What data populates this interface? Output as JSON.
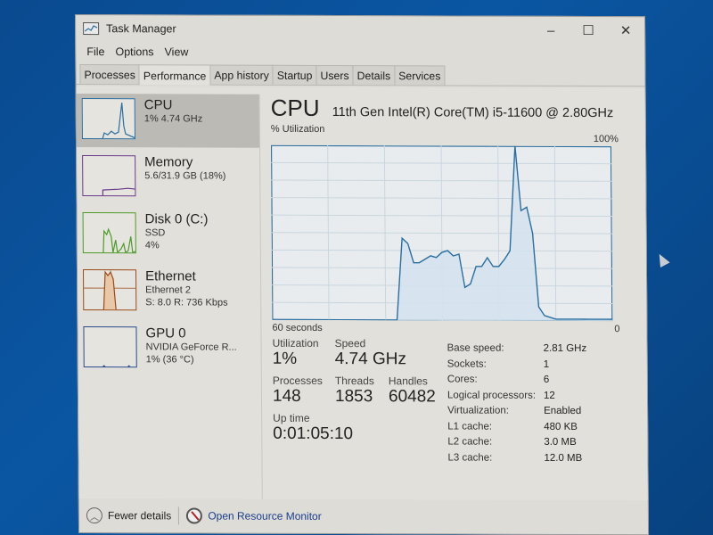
{
  "window": {
    "title": "Task Manager",
    "controls": {
      "minimize": "–",
      "maximize": "☐",
      "close": "✕"
    }
  },
  "menu": [
    "File",
    "Options",
    "View"
  ],
  "tabs": [
    {
      "label": "Processes",
      "active": false
    },
    {
      "label": "Performance",
      "active": true
    },
    {
      "label": "App history",
      "active": false
    },
    {
      "label": "Startup",
      "active": false
    },
    {
      "label": "Users",
      "active": false
    },
    {
      "label": "Details",
      "active": false
    },
    {
      "label": "Services",
      "active": false
    }
  ],
  "sidebar": {
    "items": [
      {
        "title": "CPU",
        "lines": [
          "1% 4.74 GHz"
        ],
        "color": "#2a6ea0",
        "active": true
      },
      {
        "title": "Memory",
        "lines": [
          "5.6/31.9 GB (18%)"
        ],
        "color": "#6a3a8c",
        "active": false
      },
      {
        "title": "Disk 0 (C:)",
        "lines": [
          "SSD",
          "4%"
        ],
        "color": "#4d9a2a",
        "active": false
      },
      {
        "title": "Ethernet",
        "lines": [
          "Ethernet 2",
          "S: 8.0  R: 736 Kbps"
        ],
        "color": "#9a4a1a",
        "active": false
      },
      {
        "title": "GPU 0",
        "lines": [
          "NVIDIA GeForce R...",
          "1% (36 °C)"
        ],
        "color": "#2a4a8c",
        "active": false
      }
    ]
  },
  "main": {
    "title": "CPU",
    "model": "11th Gen Intel(R) Core(TM) i5-11600 @ 2.80GHz",
    "graph_label": "% Utilization",
    "graph_max": "100%",
    "graph_left": "60 seconds",
    "graph_right": "0"
  },
  "stats": {
    "utilization_label": "Utilization",
    "utilization": "1%",
    "speed_label": "Speed",
    "speed": "4.74 GHz",
    "processes_label": "Processes",
    "processes": "148",
    "threads_label": "Threads",
    "threads": "1853",
    "handles_label": "Handles",
    "handles": "60482",
    "uptime_label": "Up time",
    "uptime": "0:01:05:10"
  },
  "specs": [
    {
      "label": "Base speed:",
      "value": "2.81 GHz"
    },
    {
      "label": "Sockets:",
      "value": "1"
    },
    {
      "label": "Cores:",
      "value": "6"
    },
    {
      "label": "Logical processors:",
      "value": "12"
    },
    {
      "label": "Virtualization:",
      "value": "Enabled"
    },
    {
      "label": "L1 cache:",
      "value": "480 KB"
    },
    {
      "label": "L2 cache:",
      "value": "3.0 MB"
    },
    {
      "label": "L3 cache:",
      "value": "12.0 MB"
    }
  ],
  "footer": {
    "fewer_details": "Fewer details",
    "resource_monitor": "Open Resource Monitor"
  },
  "colors": {
    "cpu_line": "#2a6ea0",
    "cpu_fill": "#d4e3ee",
    "grid": "#c9d6df",
    "desktop": "#0a4a8f"
  },
  "chart_data": {
    "type": "area",
    "title": "CPU % Utilization",
    "xlabel": "60 seconds",
    "ylabel": "% Utilization",
    "xlim": [
      60,
      0
    ],
    "ylim": [
      0,
      100
    ],
    "grid": true,
    "x": [
      60,
      59,
      58,
      57,
      56,
      55,
      54,
      53,
      52,
      51,
      50,
      49,
      48,
      47,
      46,
      45,
      44,
      43,
      42,
      41,
      40,
      39,
      38,
      37,
      36,
      35,
      34,
      33,
      32,
      31,
      30,
      29,
      28,
      27,
      26,
      25,
      24,
      23,
      22,
      21,
      20,
      19,
      18,
      17,
      16,
      15,
      14,
      13,
      12,
      11,
      10,
      9,
      8,
      7,
      6,
      5,
      4,
      3,
      2,
      1,
      0
    ],
    "values": [
      0,
      0,
      0,
      0,
      0,
      0,
      0,
      0,
      0,
      0,
      0,
      0,
      0,
      0,
      0,
      0,
      0,
      0,
      0,
      0,
      0,
      0,
      0,
      47,
      44,
      33,
      33,
      35,
      37,
      36,
      39,
      40,
      37,
      38,
      19,
      21,
      31,
      31,
      36,
      31,
      31,
      35,
      40,
      100,
      63,
      65,
      50,
      8,
      3,
      2,
      1,
      1,
      1,
      1,
      1,
      1,
      1,
      1,
      1,
      1,
      1
    ]
  }
}
